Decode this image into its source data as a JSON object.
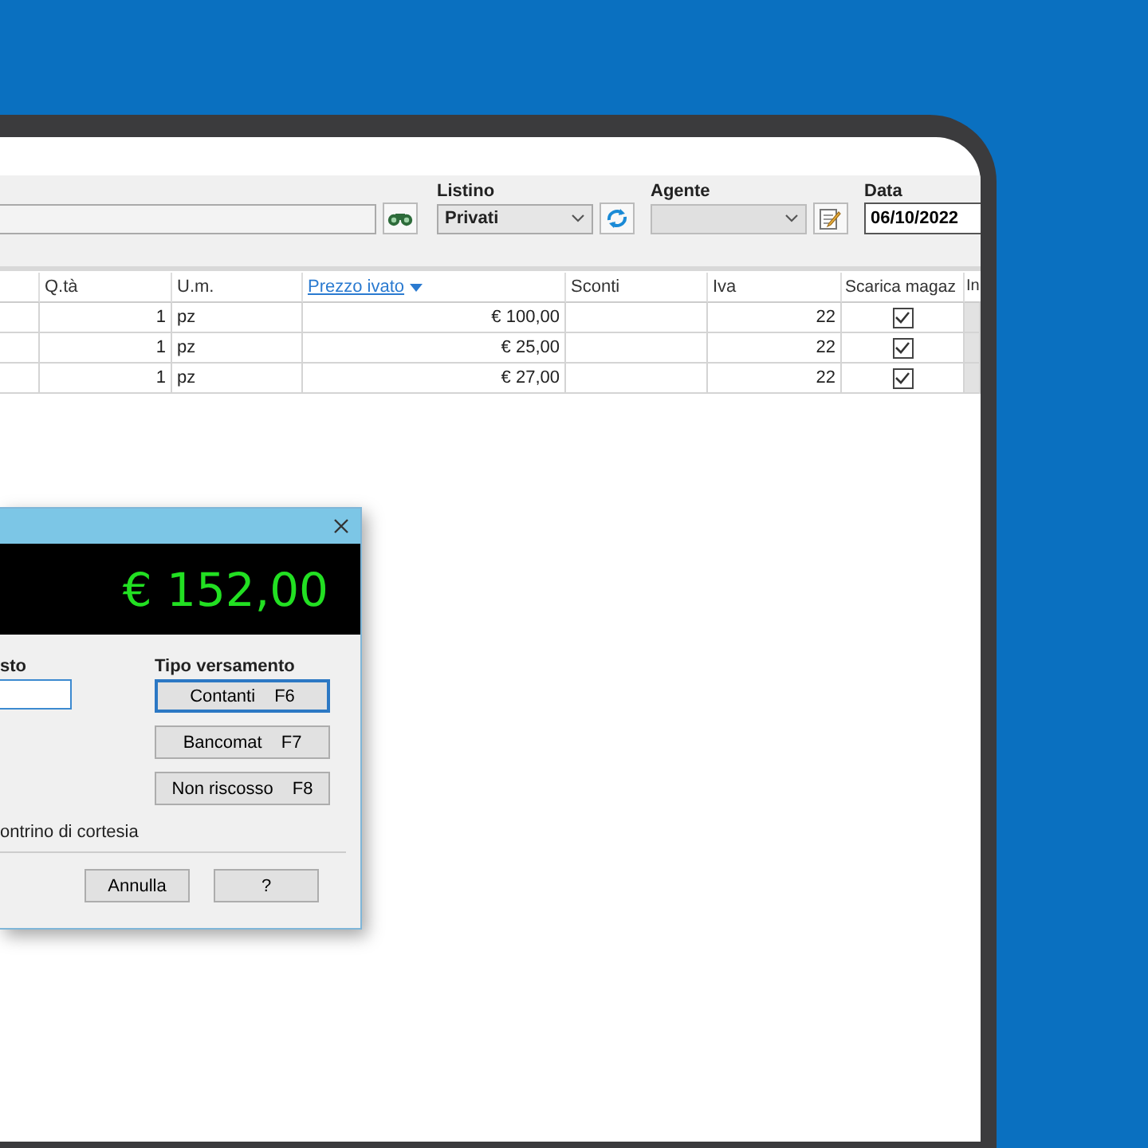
{
  "toolbar": {
    "listino": {
      "label": "Listino",
      "value": "Privati"
    },
    "agente": {
      "label": "Agente"
    },
    "data": {
      "label": "Data",
      "value": "06/10/2022"
    }
  },
  "table": {
    "columns": [
      {
        "sorted": false
      },
      {
        "label": "Q.tà",
        "sorted": false
      },
      {
        "label": "U.m.",
        "sorted": false
      },
      {
        "label": "Prezzo ivato",
        "sorted": true
      },
      {
        "label": "Sconti",
        "sorted": false
      },
      {
        "label": "Iva",
        "sorted": false
      },
      {
        "label": "Scarica magaz",
        "sorted": false
      },
      {
        "label": "In",
        "sorted": false
      }
    ],
    "rows": [
      {
        "qty": "1",
        "unit": "pz",
        "price": "€ 100,00",
        "vat": "22",
        "unload": true
      },
      {
        "qty": "1",
        "unit": "pz",
        "price": "€ 25,00",
        "vat": "22",
        "unload": true
      },
      {
        "qty": "1",
        "unit": "pz",
        "price": "€ 27,00",
        "vat": "22",
        "unload": true
      }
    ]
  },
  "dialog": {
    "total": "€ 152,00",
    "left_label": "sto",
    "payment_label": "Tipo versamento",
    "payment_buttons": [
      {
        "label": "Contanti",
        "key": "F6",
        "selected": true
      },
      {
        "label": "Bancomat",
        "key": "F7",
        "selected": false
      },
      {
        "label": "Non riscosso",
        "key": "F8",
        "selected": false
      }
    ],
    "receipt_label": "ontrino di cortesia",
    "buttons": [
      "Annulla",
      "?"
    ]
  }
}
